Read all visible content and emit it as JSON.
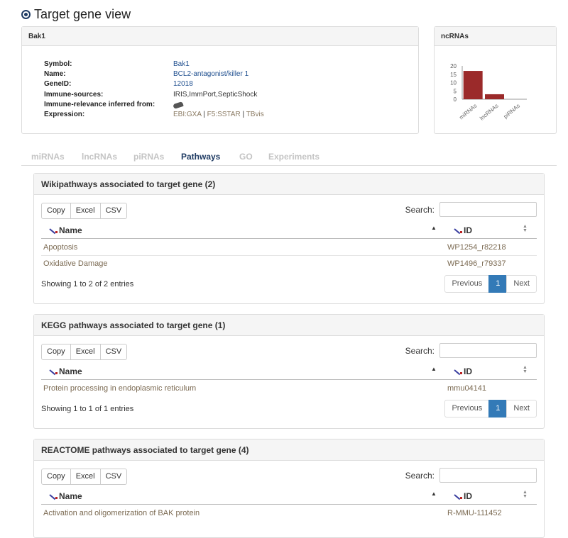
{
  "page": {
    "title": "Target gene view"
  },
  "gene": {
    "heading": "Bak1",
    "rows": [
      {
        "label": "Symbol:",
        "value": "Bak1"
      },
      {
        "label": "Name:",
        "value": "BCL2-antagonist/killer 1"
      },
      {
        "label": "GeneID:",
        "value": "12018"
      },
      {
        "label": "Immune-sources:",
        "value": "IRIS,ImmPort,SepticShock"
      },
      {
        "label": "Immune-relevance inferred from:",
        "value": ""
      },
      {
        "label": "Expression:",
        "value": ""
      }
    ],
    "expression_links": [
      "EBI:GXA",
      "F5:SSTAR",
      "TBvis"
    ],
    "expression_sep": "|"
  },
  "ncrna_panel": {
    "heading": "ncRNAs"
  },
  "chart_data": {
    "type": "bar",
    "categories": [
      "miRNAs",
      "lncRNAs",
      "piRNAs"
    ],
    "values": [
      17,
      3,
      0
    ],
    "ylim": [
      0,
      20
    ],
    "yticks": [
      0,
      5,
      10,
      15,
      20
    ],
    "bar_color": "#9b2a2a",
    "grid": false,
    "legend": "none",
    "title": "",
    "xlabel": "",
    "ylabel": ""
  },
  "tabs": [
    {
      "label": "miRNAs",
      "active": false
    },
    {
      "label": "lncRNAs",
      "active": false
    },
    {
      "label": "piRNAs",
      "active": false
    },
    {
      "label": "Pathways",
      "active": true
    },
    {
      "label": "GO",
      "active": false
    },
    {
      "label": "Experiments",
      "active": false
    }
  ],
  "export_buttons": [
    "Copy",
    "Excel",
    "CSV"
  ],
  "search_label": "Search:",
  "columns": {
    "name": "Name",
    "id": "ID"
  },
  "pager": {
    "previous": "Previous",
    "page": "1",
    "next": "Next"
  },
  "panels": [
    {
      "title": "Wikipathways associated to target gene (2)",
      "rows": [
        {
          "name": "Apoptosis",
          "id": "WP1254_r82218"
        },
        {
          "name": "Oxidative Damage",
          "id": "WP1496_r79337"
        }
      ],
      "info": "Showing 1 to 2 of 2 entries"
    },
    {
      "title": "KEGG pathways associated to target gene (1)",
      "rows": [
        {
          "name": "Protein processing in endoplasmic reticulum",
          "id": "mmu04141"
        }
      ],
      "info": "Showing 1 to 1 of 1 entries"
    },
    {
      "title": "REACTOME pathways associated to target gene (4)",
      "rows": [
        {
          "name": "Activation and oligomerization of BAK protein",
          "id": "R-MMU-111452"
        }
      ],
      "info": ""
    }
  ],
  "colors": {
    "link": "#1f4f8f",
    "active_tab": "#1f3b63",
    "pager_active": "#337ab7"
  }
}
